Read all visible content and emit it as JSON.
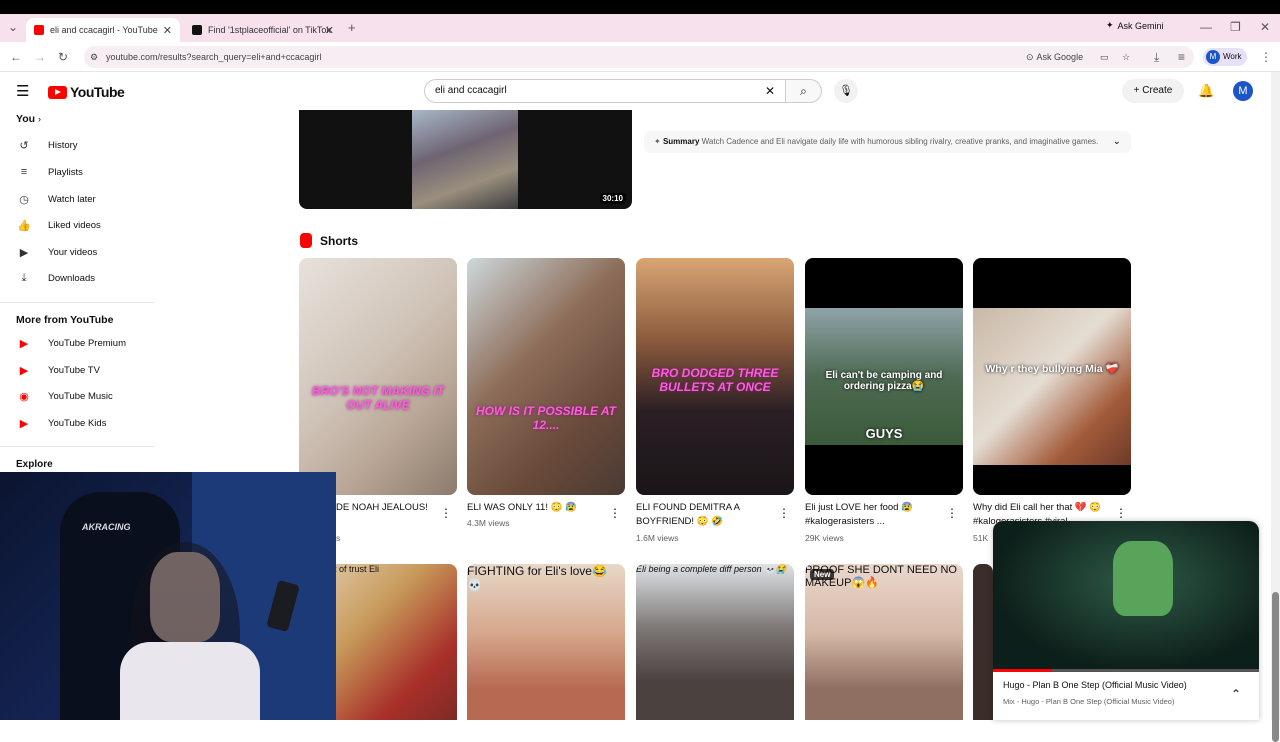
{
  "browser": {
    "tabs": [
      {
        "label": "eli and ccacagirl - YouTube"
      },
      {
        "label": "Find '1stplaceofficial' on TikTok"
      }
    ],
    "ask_gemini": "Ask Gemini",
    "url": "youtube.com/results?search_query=eli+and+ccacagirl",
    "ask_google": "Ask Google",
    "profile_label": "Work"
  },
  "header": {
    "logo_text": "YouTube",
    "search_value": "eli and ccacagirl",
    "create_label": "Create",
    "avatar_letter": "M"
  },
  "sidebar": {
    "you_label": "You",
    "items": [
      {
        "label": "History",
        "icon": "history-icon"
      },
      {
        "label": "Playlists",
        "icon": "playlists-icon"
      },
      {
        "label": "Watch later",
        "icon": "clock-icon"
      },
      {
        "label": "Liked videos",
        "icon": "thumbs-up-icon"
      },
      {
        "label": "Your videos",
        "icon": "video-icon"
      },
      {
        "label": "Downloads",
        "icon": "download-icon"
      }
    ],
    "more_heading": "More from YouTube",
    "more_items": [
      {
        "label": "YouTube Premium"
      },
      {
        "label": "YouTube TV"
      },
      {
        "label": "YouTube Music"
      },
      {
        "label": "YouTube Kids"
      }
    ],
    "explore_label": "Explore"
  },
  "top_video": {
    "duration": "30:10",
    "summary_label": "Summary",
    "summary_text": "Watch Cadence and Eli navigate daily life with humorous sibling rivalry, creative pranks, and imaginative games."
  },
  "shorts": {
    "heading": "Shorts",
    "row1": [
      {
        "caption": "BRO'S NOT MAKING IT OUT ALIVE",
        "title": "DE NOAH JEALOUS!",
        "views": "s"
      },
      {
        "caption": "HOW IS IT POSSIBLE AT 12....",
        "title": "ELI WAS ONLY 11! 😳 😰",
        "views": "4.3M views"
      },
      {
        "caption": "BRO DODGED THREE BULLETS AT ONCE",
        "title": "ELI FOUND DEMITRA A BOYFRIEND! 😳 🤣",
        "views": "1.6M views"
      },
      {
        "caption": "Eli can't be camping and ordering pizza😭",
        "caption2": "GUYS",
        "title": "Eli just LOVE her food 😰 #kalogerasisters ...",
        "views": "29K views"
      },
      {
        "caption": "Why r they bullying Mia ❤️‍🩹",
        "title": "Why did Eli call her that 💔 😳 #kalogerasisters #viral",
        "views": "51K"
      }
    ],
    "row2": [
      {
        "caption": "e amount of trust Eli"
      },
      {
        "caption": "FIGHTING for Eli's love😂 💀"
      },
      {
        "caption": "Eli being a complete diff person 💀😭"
      },
      {
        "badge": "New",
        "caption": "PROOF SHE DONT NEED NO MAKEUP😱🔥"
      }
    ]
  },
  "miniplayer": {
    "title": "Hugo - Plan B One Step (Official Music Video)",
    "subtitle": "Mix - Hugo - Plan B One Step (Official Music Video)",
    "progress": 0.22
  },
  "webcam": {
    "chair_brand": "AKRACING"
  }
}
